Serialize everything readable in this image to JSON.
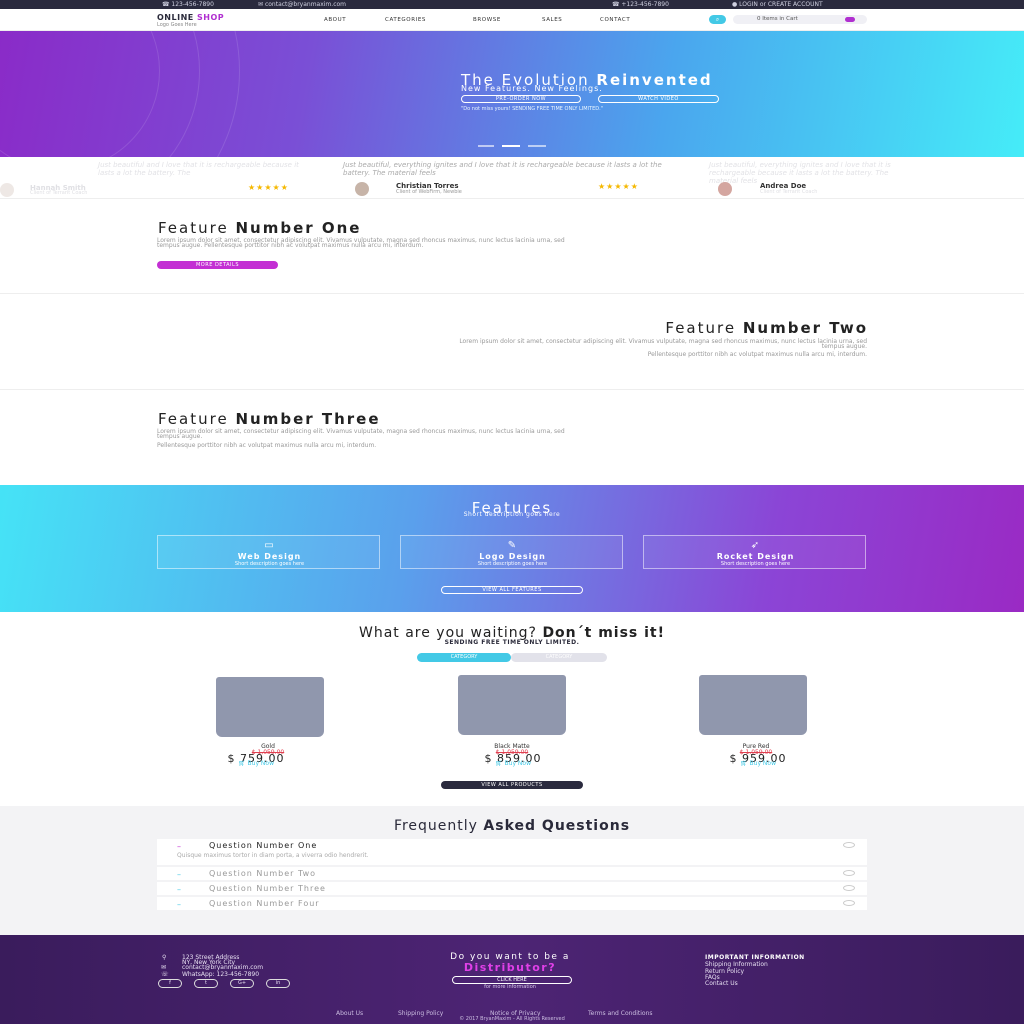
{
  "topbar": {
    "phone_left": "123-456-7890",
    "email": "contact@bryanmaxim.com",
    "phone_right": "+123-456-7890",
    "login": "LOGIN or CREATE ACCOUNT"
  },
  "header": {
    "logo_main": "ONLINE",
    "logo_accent": "SHOP",
    "logo_sub": "Logo Goes Here",
    "nav": [
      "ABOUT",
      "CATEGORIES",
      "BROWSE",
      "SALES",
      "CONTACT"
    ],
    "cart_label": "0 Items in Cart"
  },
  "hero": {
    "title_light": "The Evolution",
    "title_bold": "Reinvented",
    "subtitle": "New Features. New Feelings.",
    "btn_preorder": "PRE-ORDER NOW",
    "btn_video": "WATCH VIDEO",
    "note": "\"Do not miss yours! SENDING FREE TIME ONLY LIMITED.\""
  },
  "testimonials": [
    {
      "quote": "Just beautiful, everything ignites and I love that it is rechargeable because it lasts a lot the battery. The material feels",
      "name": "Christian Torres",
      "role": "Client of WebFirm, Newbie",
      "stars": "★★★★★"
    },
    {
      "quote": "Just beautiful, everything ignites and I love that it is rechargeable because it lasts a lot the battery. The material feels",
      "name": "Andrea Doe",
      "role": "Client of Terrarit Coach"
    },
    {
      "quote": "Just beautiful and I love that it is rechargeable because it lasts a lot the battery. The",
      "name": "Hannah Smith",
      "role": "Client of Terrarit Coach",
      "stars": "★★★★★"
    }
  ],
  "features_list": [
    {
      "title_light": "Feature",
      "title_bold": "Number One",
      "text": "Lorem ipsum dolor sit amet, consectetur adipiscing elit. Vivamus vulputate, magna sed rhoncus maximus, nunc lectus lacinia urna, sed tempus augue. Pellentesque porttitor nibh ac volutpat maximus nulla arcu mi, interdum.",
      "button": "MORE DETAILS"
    },
    {
      "title_light": "Feature",
      "title_bold": "Number Two",
      "text": "Lorem ipsum dolor sit amet, consectetur adipiscing elit. Vivamus vulputate, magna sed rhoncus maximus, nunc lectus lacinia urna, sed tempus augue.",
      "text2": "Pellentesque porttitor nibh ac volutpat maximus nulla arcu mi, interdum."
    },
    {
      "title_light": "Feature",
      "title_bold": "Number Three",
      "text": "Lorem ipsum dolor sit amet, consectetur adipiscing elit. Vivamus vulputate, magna sed rhoncus maximus, nunc lectus lacinia urna, sed tempus augue.",
      "text2": "Pellentesque porttitor nibh ac volutpat maximus nulla arcu mi, interdum."
    }
  ],
  "features_section": {
    "title": "Features",
    "subtitle": "Short description goes here",
    "cards": [
      {
        "name": "Web Design",
        "desc": "Short description goes here",
        "icon": "monitor-icon"
      },
      {
        "name": "Logo Design",
        "desc": "Short description goes here",
        "icon": "brush-icon"
      },
      {
        "name": "Rocket Design",
        "desc": "Short description goes here",
        "icon": "rocket-icon"
      }
    ],
    "button": "VIEW ALL FEATURES"
  },
  "shop": {
    "title_light": "What are you waiting?",
    "title_bold": "Don´t miss it!",
    "subtitle": "SENDING FREE TIME ONLY LIMITED.",
    "tabs": [
      "CATEGORY",
      "CATEGORY"
    ],
    "products": [
      {
        "name": "Gold",
        "old": "$ 1,059.00",
        "price": "$ 759.00",
        "buy": "Buy Now"
      },
      {
        "name": "Black Matte",
        "old": "$ 1,059.00",
        "price": "$ 859.00",
        "buy": "Buy Now"
      },
      {
        "name": "Pure Red",
        "old": "$ 1,059.00",
        "price": "$ 959.00",
        "buy": "Buy Now"
      }
    ],
    "button": "VIEW ALL PRODUCTS"
  },
  "faq": {
    "title_light": "Frequently",
    "title_bold": "Asked Questions",
    "items": [
      {
        "q": "Question Number One",
        "a": "Quisque maximus tortor in diam porta, a viverra odio hendrerit."
      },
      {
        "q": "Question Number Two"
      },
      {
        "q": "Question Number Three"
      },
      {
        "q": "Question Number Four"
      }
    ]
  },
  "footer": {
    "address1": "123 Street Address",
    "address2": "NY, New York City",
    "email": "contact@bryanmaxim.com",
    "whatsapp": "WhatsApp: 123-456-7890",
    "social": [
      "f",
      "t",
      "G+",
      "in"
    ],
    "dist_q": "Do you want to be a",
    "dist": "Distributor?",
    "click": "CLICK HERE",
    "more": "for more information",
    "imp_title": "IMPORTANT INFORMATION",
    "imp_items": [
      "Shipping Information",
      "Return Policy",
      "FAQs",
      "Contact Us"
    ],
    "links": [
      "About Us",
      "Shipping Policy",
      "Notice of Privacy",
      "Terms and Conditions"
    ],
    "copyright": "© 2017 BryanMaxim - All Rights Reserved"
  },
  "colors": {
    "accent_purple": "#b02fd0",
    "accent_cyan": "#43c9e6",
    "dark": "#2a2a3e"
  }
}
